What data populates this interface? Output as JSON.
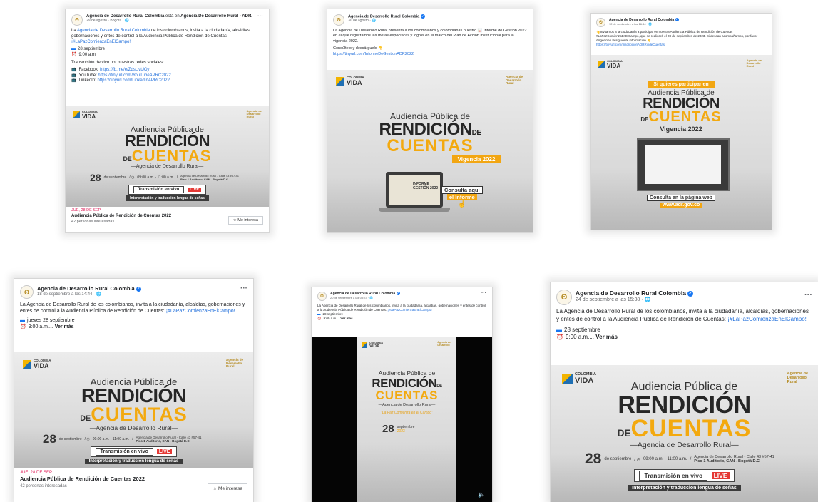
{
  "posts": [
    {
      "page_name": "Agencia de Desarrollo Rural Colombia",
      "page_suffix": "está en",
      "location": "Agencia De Desarrollo Rural - ADR.",
      "date": "29 de agosto · Bogotá · 🌐",
      "text_before_link": "La ",
      "text_link": "Agencia de Desarrollo Rural Colombia",
      "text_after_link": " de los colombianos, invita a la ciudadanía, alcaldías, gobernaciones y entes de control a la Audiencia Pública de Rendición de Cuentas:",
      "hashtag": "¡#LaPazComienzaEnElCampo!",
      "day_line": "28 septiembre",
      "time_line": "9:00 a.m.",
      "stream_intro": "Transmisión de vivo por nuestras redes sociales:",
      "social_links": [
        {
          "label": "Facebook: ",
          "url": "https://fb.me/e/ZdsUvtJOy"
        },
        {
          "label": "YouTube: ",
          "url": "https://tinyurl.com/YouTubeAPRC2022"
        },
        {
          "label": "LinkedIn: ",
          "url": "https://tinyurl.com/LinkedInAPRC2022"
        }
      ],
      "event_date": "JUE, 28 DE SEP.",
      "event_title": "Audiencia Pública de Rendición de Cuentas 2022",
      "event_sub": "42 personas interesadas",
      "interest_button": "☆ Me interesa"
    },
    {
      "page_name": "Agencia de Desarrollo Rural Colombia",
      "date": "30 de agosto · 🌐",
      "text": "La Agencia de Desarrollo Rural presenta a los colombianos y colombianas nuestro 📊 Informe de Gestión 2022 en el que registramos las metas específicas y logros en el marco del Plan de Acción Institucional para la vigencia 2022.",
      "text2": "Consúltelo y descárguelo 👇",
      "link": "https://tinyurl.com/InformeDeGestionADR2022",
      "vigencia": "Vigencia 2022",
      "laptop_text": "INFORME GESTIÓN 2022",
      "cta_line1": "Consulta aquí",
      "cta_line2": "el Informe"
    },
    {
      "page_name": "Agencia de Desarrollo Rural Colombia",
      "date": "12 de septiembre a las 16:44 · 🌐",
      "text": "👆Invitamos a la ciudadanía a participar en nuestra Audiencia Pública de Rendición de Cuentas #LaPazComienzaEnElCampo, que se realizará el 28 de septiembre de 2023. Si desean acompañarnos, por favor diligencien la siguiente información 👇",
      "link": "https://tinyurl.com/InscripcionADRRindeCuentas",
      "tag": "Si quieres participar en",
      "vigencia": "Vigencia 2022",
      "cta_line1": "Consulta en la página web",
      "cta_line2": "www.adr.gov.co"
    },
    {
      "page_name": "Agencia de Desarrollo Rural Colombia",
      "date": "18 de septiembre a las 14:44 · 🌐",
      "text": "La Agencia de Desarrollo Rural de los colombianos, invita a la ciudadanía, alcaldías, gobernaciones y entes de control a la Audiencia Pública de Rendición de Cuentas:",
      "hashtag": "¡#LaPazComienzaEnElCampo!",
      "day_line": "jueves 28 septiembre",
      "time_line": "9:00 a.m....",
      "more": "Ver más",
      "event_date": "JUE, 28 DE SEP.",
      "event_title": "Audiencia Pública de Rendición de Cuentas 2022",
      "event_sub": "42 personas interesadas",
      "interest_button": "☆ Me interesa"
    },
    {
      "page_name": "Agencia de Desarrollo Rural Colombia",
      "date": "20 de septiembre a las 08:23 · 🌐",
      "text": "La Agencia de Desarrollo Rural de los colombianos, invita a la ciudadanía, alcaldías, gobernaciones y entes de control a la Audiencia Pública de Rendición de Cuentas:",
      "hashtag": "¡#LaPazComienzaEnElCampo!",
      "day_line": "28 septiembre",
      "time_line": "9:00 a.m....",
      "more": "Ver más",
      "slogan": "\"La Paz Comienza en el Campo\"",
      "day_num": "28",
      "day_month": "septiembre",
      "year": "2023"
    },
    {
      "page_name": "Agencia de Desarrollo Rural Colombia",
      "date": "24 de septiembre a las 15:38 · 🌐",
      "text": "La Agencia de Desarrollo Rural de los colombianos, invita a la ciudadanía, alcaldías, gobernaciones y entes de control a la Audiencia Pública de Rendición de Cuentas:",
      "hashtag": "¡#LaPazComienzaEnElCampo!",
      "day_line": "28 septiembre",
      "time_line": "9:00 a.m....",
      "more": "Ver más"
    }
  ],
  "banner": {
    "logo_left_1": "COLOMBIA",
    "logo_left_2": "POTENCIA DE LA",
    "logo_left_3": "VIDA",
    "logo_right_1": "Agencia de",
    "logo_right_2": "Desarrollo",
    "logo_right_3": "Rural",
    "title_1": "Audiencia Pública de",
    "title_2": "RENDICIÓN",
    "title_de": "DE",
    "title_3": "CUENTAS",
    "subtitle": "—Agencia de Desarrollo Rural—",
    "date_num": "28",
    "date_month": "de septiembre",
    "date_year": "2023",
    "time": "09:00 a.m. - 11:00 a.m.",
    "place_1": "Agencia de Desarrollo Rural - Calle 43 #57-41",
    "place_2": "Piso 1 Auditorio, CAN - Bogotá D.C",
    "live_text": "Transmisión en vivo",
    "live_tag": "LIVE",
    "sign": "Interpretación y traducción lengua de señas"
  },
  "more_icon": "more-options-icon",
  "colors": {
    "accent": "#f3a90f",
    "link": "#216fdb",
    "event_date": "#e0245e",
    "live": "#e53935"
  }
}
